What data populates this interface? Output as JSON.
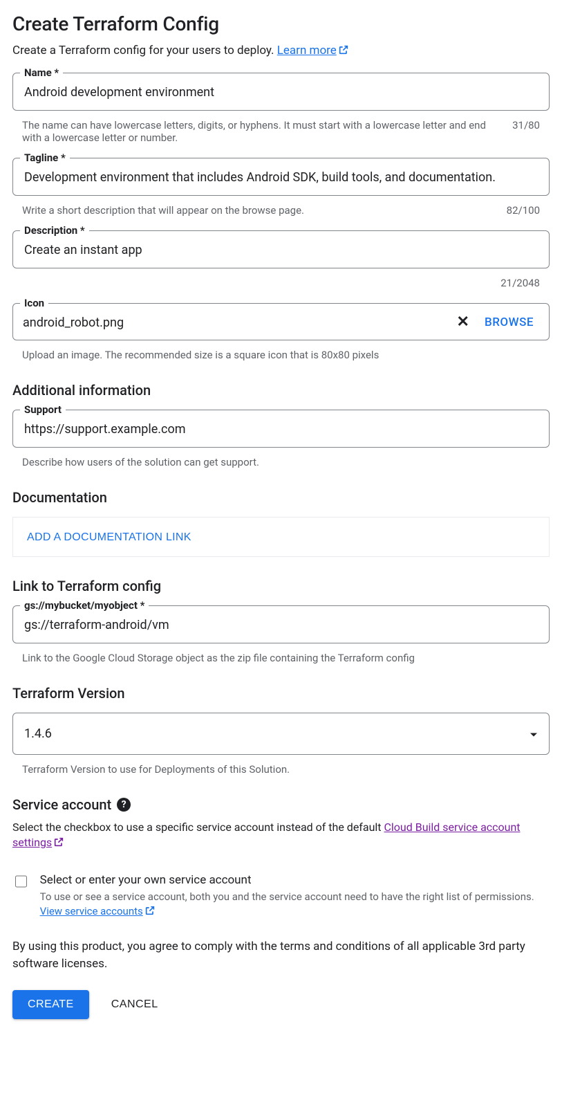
{
  "pageTitle": "Create Terraform Config",
  "subtitle": "Create a Terraform config for your users to deploy. ",
  "learnMore": "Learn more",
  "name": {
    "label": "Name *",
    "value": "Android development environment",
    "helper": "The name can have lowercase letters, digits, or hyphens. It must start with a lowercase letter and end with a lowercase letter or number.",
    "counter": "31/80"
  },
  "tagline": {
    "label": "Tagline *",
    "value": "Development environment that includes Android SDK, build tools, and documentation.",
    "helper": "Write a short description that will appear on the browse page.",
    "counter": "82/100"
  },
  "description": {
    "label": "Description *",
    "value": "Create an instant app",
    "counter": "21/2048"
  },
  "icon": {
    "label": "Icon",
    "value": "android_robot.png",
    "browse": "BROWSE",
    "helper": "Upload an image. The recommended size is a square icon that is 80x80 pixels"
  },
  "additionalInfoHeading": "Additional information",
  "support": {
    "label": "Support",
    "value": "https://support.example.com",
    "helper": "Describe how users of the solution can get support."
  },
  "documentationHeading": "Documentation",
  "addDocLink": "ADD A DOCUMENTATION LINK",
  "linkToTfHeading": "Link to Terraform config",
  "tfLink": {
    "label": "gs://mybucket/myobject *",
    "value": "gs://terraform-android/vm",
    "helper": "Link to the Google Cloud Storage object as the zip file containing the Terraform config"
  },
  "tfVersionHeading": "Terraform Version",
  "tfVersion": {
    "value": "1.4.6",
    "helper": "Terraform Version to use for Deployments of this Solution."
  },
  "serviceAccountHeading": "Service account",
  "serviceAccountDesc1": "Select the checkbox to use a specific service account instead of the default ",
  "serviceAccountLink": "Cloud Build service account settings",
  "svcCheckbox": {
    "label": "Select or enter your own service account",
    "sub1": "To use or see a service account, both you and the service account need to have the right list of permissions. ",
    "viewLink": "View service accounts"
  },
  "agreeText": "By using this product, you agree to comply with the terms and conditions of all applicable 3rd party software licenses.",
  "createBtn": "CREATE",
  "cancelBtn": "CANCEL"
}
